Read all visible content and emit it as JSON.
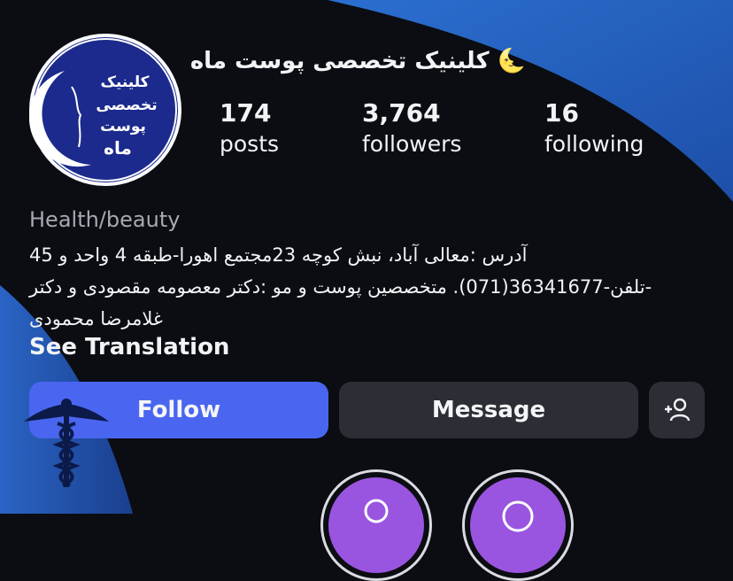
{
  "profile": {
    "name": "🌜 کلینیک تخصصی پوست ماه",
    "logo_text": [
      "کلینیک",
      "تخصصی",
      "پوست",
      "ماه"
    ],
    "stats": [
      {
        "value": "174",
        "label": "posts"
      },
      {
        "value": "3,764",
        "label": "followers"
      },
      {
        "value": "16",
        "label": "following"
      }
    ],
    "category": "Health/beauty",
    "bio": "آدرس :معالی آباد، نبش کوچه 23مجتمع اهورا-طبقه 4 واحد و 45 -تلفن-36341677(071). متخصصین پوست و مو :دکتر معصومه مقصودی و دکتر غلامرضا محمودی",
    "see_translation": "See Translation"
  },
  "actions": {
    "follow": "Follow",
    "message": "Message",
    "add_icon": "person-plus-icon"
  },
  "colors": {
    "background": "#0b0d12",
    "follow_button": "#4a66f0",
    "secondary_button": "#2b2e35",
    "category_text": "#a7a9b1",
    "accent_blue": "#2f78c9",
    "logo_navy": "#1b2a8c"
  }
}
